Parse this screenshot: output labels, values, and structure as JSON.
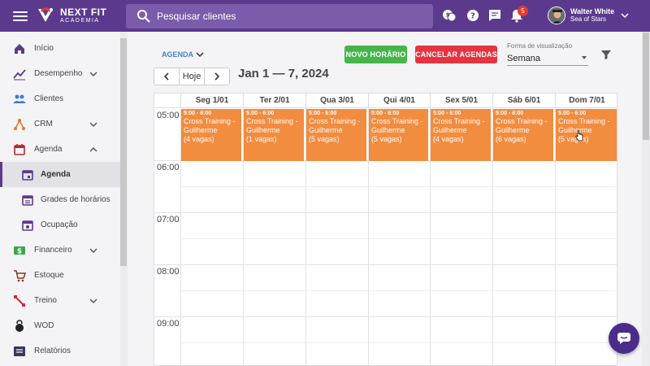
{
  "header": {
    "logo_line1": "NEXT FIT",
    "logo_line2": "ACADEMIA",
    "search_placeholder": "Pesquisar clientes",
    "notification_count": "5",
    "user_name": "Walter White",
    "user_subtitle": "Sea of Stars"
  },
  "sidebar": {
    "items": [
      {
        "label": "Início",
        "icon": "home-icon"
      },
      {
        "label": "Desempenho",
        "icon": "trending-up-icon"
      },
      {
        "label": "Clientes",
        "icon": "people-icon"
      },
      {
        "label": "CRM",
        "icon": "crm-icon"
      },
      {
        "label": "Agenda",
        "icon": "calendar-icon"
      },
      {
        "label": "Agenda",
        "icon": "calendar-today-icon"
      },
      {
        "label": "Grades de horários",
        "icon": "calendar-grid-icon"
      },
      {
        "label": "Ocupação",
        "icon": "calendar-occupancy-icon"
      },
      {
        "label": "Financeiro",
        "icon": "money-icon"
      },
      {
        "label": "Estoque",
        "icon": "cart-icon"
      },
      {
        "label": "Treino",
        "icon": "workout-icon"
      },
      {
        "label": "WOD",
        "icon": "kettlebell-icon"
      },
      {
        "label": "Relatórios",
        "icon": "reports-icon"
      }
    ]
  },
  "toolbar": {
    "view_label": "AGENDA",
    "new_button": "NOVO HORÁRIO",
    "cancel_button": "CANCELAR AGENDAS",
    "visualization_label": "Forma de visualização",
    "visualization_value": "Semana",
    "today_label": "Hoje",
    "date_range": "Jan 1 — 7, 2024"
  },
  "calendar": {
    "days": [
      "Seg 1/01",
      "Ter 2/01",
      "Qua 3/01",
      "Qui 4/01",
      "Sex 5/01",
      "Sáb 6/01",
      "Dom 7/01"
    ],
    "hours": [
      "05:00",
      "06:00",
      "07:00",
      "08:00",
      "09:00"
    ],
    "events": [
      {
        "time": "5:00 - 6:00",
        "title": "Cross Training - Guilherme",
        "vagas": "(4 vagas)"
      },
      {
        "time": "5:00 - 6:00",
        "title": "Cross Training - Guilherme",
        "vagas": "(1 vagas)"
      },
      {
        "time": "5:00 - 6:00",
        "title": "Cross Training - Guilherme",
        "vagas": "(5 vagas)"
      },
      {
        "time": "5:00 - 6:00",
        "title": "Cross Training - Guilherme",
        "vagas": "(5 vagas)"
      },
      {
        "time": "5:00 - 6:00",
        "title": "Cross Training - Guilherme",
        "vagas": "(4 vagas)"
      },
      {
        "time": "5:00 - 6:00",
        "title": "Cross Training - Guilherme",
        "vagas": "(6 vagas)"
      },
      {
        "time": "5:00 - 6:00",
        "title": "Cross Training - Guilherme",
        "vagas": "(5 vagas)"
      }
    ]
  },
  "colors": {
    "primary": "#5b3a8e",
    "event": "#f28c3f",
    "new_button": "#46b54a",
    "cancel_button": "#e53340"
  }
}
